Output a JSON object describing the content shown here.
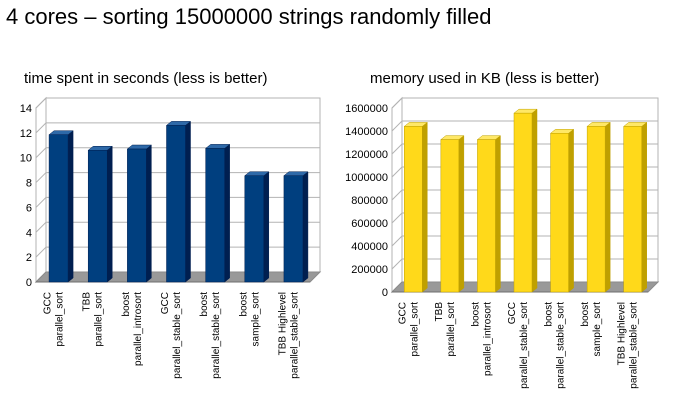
{
  "page": {
    "title": "4 cores – sorting 15000000 strings randomly filled"
  },
  "chart_data": [
    {
      "type": "bar",
      "title": "time spent in seconds (less is better)",
      "categories": [
        [
          "GCC",
          "parallel_sort"
        ],
        [
          "TBB",
          "parallel_sort"
        ],
        [
          "boost",
          "parallel_introsort"
        ],
        [
          "GCC",
          "parallel_stable_sort"
        ],
        [
          "boost",
          "parallel_stable_sort"
        ],
        [
          "boost",
          "sample_sort"
        ],
        [
          "TBB Highlevel",
          "parallel_stable_sort"
        ]
      ],
      "values": [
        11.85,
        10.6,
        10.7,
        12.6,
        10.75,
        8.55,
        8.55
      ],
      "ylim": [
        0,
        14
      ],
      "yticks": [
        0,
        2,
        4,
        6,
        8,
        10,
        12,
        14
      ],
      "grid": true,
      "bar_style": "3d",
      "colors": {
        "front": "#003f7f",
        "side": "#001f50",
        "top": "#2e69a8"
      }
    },
    {
      "type": "bar",
      "title": "memory used in KB (less is better)",
      "categories": [
        [
          "GCC",
          "parallel_sort"
        ],
        [
          "TBB",
          "parallel_sort"
        ],
        [
          "boost",
          "parallel_introsort"
        ],
        [
          "GCC",
          "parallel_stable_sort"
        ],
        [
          "boost",
          "parallel_stable_sort"
        ],
        [
          "boost",
          "sample_sort"
        ],
        [
          "TBB Highlevel",
          "parallel_stable_sort"
        ]
      ],
      "values": [
        1440000,
        1325000,
        1325000,
        1555000,
        1380000,
        1440000,
        1440000
      ],
      "ylim": [
        0,
        1600000
      ],
      "yticks": [
        0,
        200000,
        400000,
        600000,
        800000,
        1000000,
        1200000,
        1400000,
        1600000
      ],
      "grid": true,
      "bar_style": "3d",
      "colors": {
        "front": "#ffd91a",
        "side": "#bfa000",
        "top": "#ffe866"
      }
    }
  ]
}
